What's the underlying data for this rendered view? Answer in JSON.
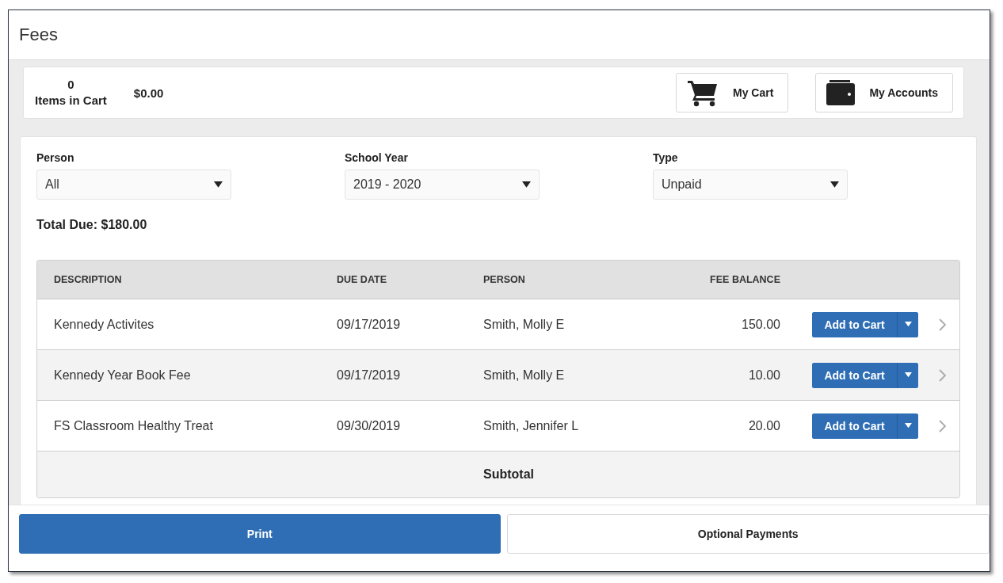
{
  "window": {
    "title": "Fees"
  },
  "cart_summary": {
    "count": "0",
    "count_label": "Items in Cart",
    "total": "$0.00",
    "buttons": [
      {
        "label": "My Cart",
        "kind": "cart"
      },
      {
        "label": "My Accounts",
        "kind": "wallet"
      }
    ]
  },
  "filters": [
    {
      "label": "Person",
      "value": "All"
    },
    {
      "label": "School Year",
      "value": "2019 - 2020"
    },
    {
      "label": "Type",
      "value": "Unpaid"
    }
  ],
  "total_due": "Total Due: $180.00",
  "table": {
    "columns": [
      "DESCRIPTION",
      "DUE DATE",
      "PERSON",
      "FEE BALANCE"
    ],
    "rows": [
      {
        "description": "Kennedy Activites",
        "due_date": "09/17/2019",
        "person": "Smith, Molly E",
        "fee_balance": "150.00",
        "action": "Add to Cart"
      },
      {
        "description": "Kennedy Year Book Fee",
        "due_date": "09/17/2019",
        "person": "Smith, Molly E",
        "fee_balance": "10.00",
        "action": "Add to Cart"
      },
      {
        "description": "FS Classroom Healthy Treat",
        "due_date": "09/30/2019",
        "person": "Smith, Jennifer L",
        "fee_balance": "20.00",
        "action": "Add to Cart"
      }
    ],
    "subtotal_label": "Subtotal"
  },
  "footer_buttons": [
    {
      "label": "Print",
      "primary": true
    },
    {
      "label": "Optional Payments",
      "primary": false
    }
  ]
}
